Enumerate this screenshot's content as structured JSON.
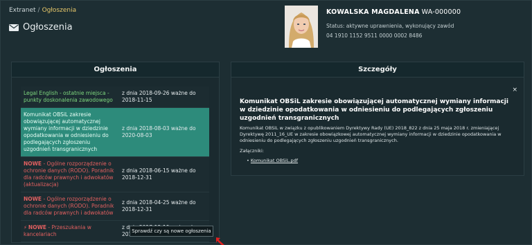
{
  "header": {
    "breadcrumb_root": "Extranet",
    "breadcrumb_separator": "/",
    "breadcrumb_current": "Ogłoszenia",
    "page_title": "Ogłoszenia",
    "title_icon": "envelope-icon"
  },
  "user": {
    "name": "KOWALSKA MAGDALENA",
    "id": "WA-000000",
    "status": "Status: aktywne uprawnienia, wykonujący zawód",
    "account": "04 1910 1152 9511 0000 0002 8486"
  },
  "announcements_panel": {
    "title": "Ogłoszenia",
    "items": [
      {
        "prefix": "",
        "title": "Legal English - ostatnie miejsca - punkty doskonalenia zawodowego",
        "dates": "z dnia 2018-09-26 ważne do 2018-11-15",
        "color": "#7ed87e",
        "selected": false
      },
      {
        "prefix": "",
        "title": "Komunikat OBSiL zakresie obowiązującej automatycznej wymiany informacji w dziedzinie opodatkowania w odniesieniu do podlegających zgłoszeniu uzgodnień transgranicznych",
        "dates": "z dnia 2018-08-03 ważne do 2020-08-03",
        "color": "#7ed87e",
        "selected": true
      },
      {
        "prefix": "NOWE",
        "title": " - Ogólne rozporządzenie o ochronie danych (RODO). Poradnik dla radców prawnych i adwokatów (aktualizacja)",
        "dates": "z dnia 2018-06-15 ważne do 2018-12-31",
        "color": "#e36060",
        "selected": false
      },
      {
        "prefix": "NOWE",
        "title": " - Ogólne rozporządzenie o ochronie danych (RODO). Poradnik dla radców prawnych i adwokatów",
        "dates": "z dnia 2018-04-25 ważne do 2018-12-31",
        "color": "#e36060",
        "selected": false
      },
      {
        "prefix": "NOWE",
        "title": " - Przeszukania w kancelariach",
        "dates": "z dnia 2017-12-19 ważne do 2019-12-19",
        "color": "#e36060",
        "selected": false,
        "icon": "lightning-icon"
      }
    ],
    "check_button": "Sprawdź czy są nowe ogłoszenia"
  },
  "details_panel": {
    "title": "Szczegóły",
    "close_symbol": "×",
    "heading": "Komunikat OBSiL zakresie obowiązującej automatycznej wymiany informacji w dziedzinie opodatkowania w odniesieniu do podlegających zgłoszeniu uzgodnień transgranicznych",
    "body": "Komunikat OBSiL w związku z opublikowaniem Dyrektywy Rady (UE) 2018_822 z dnia 25 maja 2018 r. zmieniającej Dyrektywę 2011_16_UE w zakresie obowiązkowej automatycznej wymiany informacji w dziedzinie opodatkowania w odniesieniu do podlegających zgłoszeniu uzgodnień transgranicznych.",
    "attachments_label": "Załączniki:",
    "attachments": [
      "Komunikat OBSiL.pdf"
    ]
  },
  "colors": {
    "background": "#1d2e33",
    "selected_row": "#2d8b7b",
    "accent_breadcrumb": "#e8c86a",
    "new_red": "#e36060",
    "green": "#7ed87e"
  }
}
